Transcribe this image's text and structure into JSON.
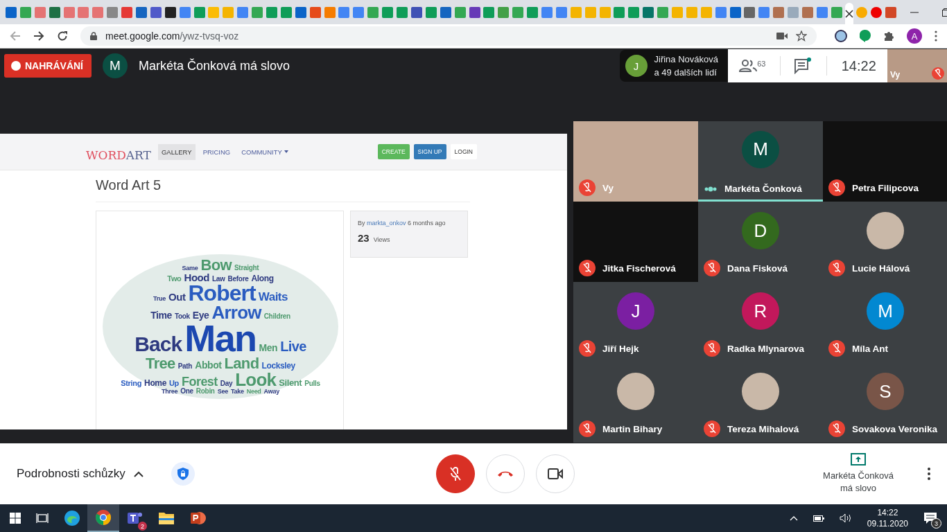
{
  "browser": {
    "url_host": "meet.google.com",
    "url_path": "/ywz-tvsq-voz",
    "profile_initial": "A"
  },
  "header": {
    "recording_label": "NAHRÁVÁNÍ",
    "speaker_initial": "M",
    "speaker_title": "Markéta Čonková má slovo",
    "presenter_chip": {
      "initial": "J",
      "name": "Jiřina Nováková",
      "more": "a 49 dalších lidí"
    },
    "people_count": "63",
    "time": "14:22",
    "self_view": {
      "label": "Vy",
      "muted": true
    }
  },
  "presentation": {
    "logo_top": "WORD",
    "logo_bottom": "ART",
    "nav": [
      {
        "label": "GALLERY",
        "selected": true
      },
      {
        "label": "PRICING",
        "selected": false
      },
      {
        "label": "COMMUNITY",
        "selected": false
      }
    ],
    "buttons": [
      {
        "label": "CREATE",
        "kind": "create"
      },
      {
        "label": "SIGN UP",
        "kind": "signup"
      },
      {
        "label": "LOGIN",
        "kind": "login"
      }
    ],
    "title": "Word Art 5",
    "by": "By",
    "author": "markta_onkov",
    "ago": "6 months ago",
    "views_count": "23",
    "views_label": "Views",
    "words": [
      {
        "text": "Same",
        "color": "#2e3a80"
      },
      {
        "text": "Bow",
        "color": "#4e9a6e"
      },
      {
        "text": "Straight",
        "color": "#4e9a6e"
      },
      {
        "text": "Two",
        "color": "#4e9a6e"
      },
      {
        "text": "Hood",
        "color": "#2e3a80"
      },
      {
        "text": "Law",
        "color": "#2e3a80"
      },
      {
        "text": "Before",
        "color": "#2e3a80"
      },
      {
        "text": "Along",
        "color": "#2e3a80"
      },
      {
        "text": "True",
        "color": "#2e3a80"
      },
      {
        "text": "Out",
        "color": "#2e3a80"
      },
      {
        "text": "Robert",
        "color": "#2a5cc0"
      },
      {
        "text": "Waits",
        "color": "#2a5cc0"
      },
      {
        "text": "Time",
        "color": "#2e3a80"
      },
      {
        "text": "Took",
        "color": "#2e3a80"
      },
      {
        "text": "Eye",
        "color": "#2e3a80"
      },
      {
        "text": "Arrow",
        "color": "#2a5cc0"
      },
      {
        "text": "Children",
        "color": "#4e9a6e"
      },
      {
        "text": "Back",
        "color": "#2e3a80"
      },
      {
        "text": "Man",
        "color": "#1c48b0"
      },
      {
        "text": "Men",
        "color": "#4e9a6e"
      },
      {
        "text": "Live",
        "color": "#2a5cc0"
      },
      {
        "text": "Tree",
        "color": "#4e9a6e"
      },
      {
        "text": "Path",
        "color": "#2e3a80"
      },
      {
        "text": "Abbot",
        "color": "#4e9a6e"
      },
      {
        "text": "Land",
        "color": "#4e9a6e"
      },
      {
        "text": "Locksley",
        "color": "#2a5cc0"
      },
      {
        "text": "String",
        "color": "#2a5cc0"
      },
      {
        "text": "Home",
        "color": "#2e3a80"
      },
      {
        "text": "Up",
        "color": "#2a5cc0"
      },
      {
        "text": "Forest",
        "color": "#4e9a6e"
      },
      {
        "text": "Day",
        "color": "#2e3a80"
      },
      {
        "text": "Look",
        "color": "#4e9a6e"
      },
      {
        "text": "Silent",
        "color": "#4e9a6e"
      },
      {
        "text": "Pulls",
        "color": "#4e9a6e"
      },
      {
        "text": "Three",
        "color": "#2e3a80"
      },
      {
        "text": "One",
        "color": "#2e3a80"
      },
      {
        "text": "Robin",
        "color": "#4e9a6e"
      },
      {
        "text": "See",
        "color": "#2e3a80"
      },
      {
        "text": "Take",
        "color": "#2e3a80"
      },
      {
        "text": "Need",
        "color": "#4e9a6e"
      },
      {
        "text": "Away",
        "color": "#2e3a80"
      }
    ]
  },
  "participants": [
    {
      "name": "Vy",
      "kind": "video",
      "muted": true,
      "speaking": false
    },
    {
      "name": "Markéta Čonková",
      "kind": "avatar",
      "initial": "M",
      "color": "#0b4f43",
      "muted": false,
      "speaking": true
    },
    {
      "name": "Petra Filipcova",
      "kind": "blank",
      "muted": true,
      "speaking": false
    },
    {
      "name": "Jitka Fischerová",
      "kind": "blank",
      "muted": true,
      "speaking": false
    },
    {
      "name": "Dana Fisková",
      "kind": "avatar",
      "initial": "D",
      "color": "#33691e",
      "muted": true,
      "speaking": false
    },
    {
      "name": "Lucie Hálová",
      "kind": "photo",
      "muted": true,
      "speaking": false
    },
    {
      "name": "Jiří Hejk",
      "kind": "avatar",
      "initial": "J",
      "color": "#7b1fa2",
      "muted": true,
      "speaking": false
    },
    {
      "name": "Radka Mlynarova",
      "kind": "avatar",
      "initial": "R",
      "color": "#c2185b",
      "muted": true,
      "speaking": false
    },
    {
      "name": "Míla Ant",
      "kind": "avatar",
      "initial": "M",
      "color": "#0288d1",
      "muted": true,
      "speaking": false
    },
    {
      "name": "Martin Bihary",
      "kind": "photo",
      "muted": true,
      "speaking": false
    },
    {
      "name": "Tereza Mihalová",
      "kind": "photo",
      "muted": true,
      "speaking": false
    },
    {
      "name": "Sovakova Veronika",
      "kind": "avatar",
      "initial": "S",
      "color": "#795548",
      "muted": true,
      "speaking": false
    }
  ],
  "controls": {
    "details_label": "Podrobnosti schůzky",
    "mic_muted": true,
    "presenting_label": "Markéta Čonková má slovo"
  },
  "taskbar": {
    "teams_badge": "2",
    "time": "14:22",
    "date": "09.11.2020",
    "notifications": "3"
  }
}
